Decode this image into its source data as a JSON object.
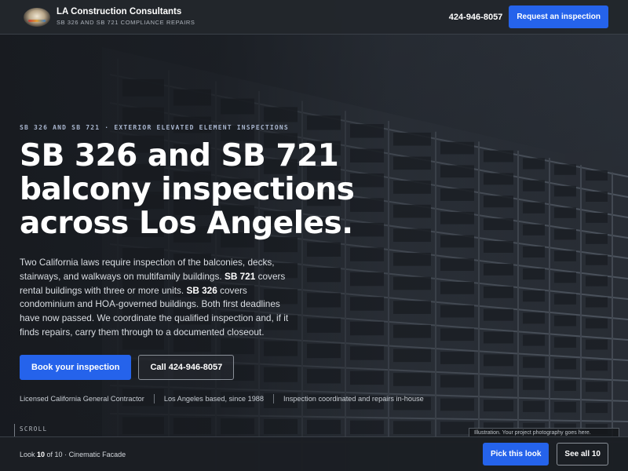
{
  "header": {
    "brand_name": "LA Construction Consultants",
    "brand_sub": "SB 326 AND SB 721 COMPLIANCE REPAIRS",
    "phone": "424-946-8057",
    "cta_label": "Request an inspection"
  },
  "hero": {
    "eyebrow": "SB 326 AND SB 721 · EXTERIOR ELEVATED ELEMENT INSPECTIONS",
    "headline": "SB 326 and SB 721 balcony inspections across Los Angeles.",
    "lede": {
      "part1": "Two California laws require inspection of the balconies, decks, stairways, and walkways on multifamily buildings. ",
      "sb721": "SB 721",
      "part2": " covers rental buildings with three or more units. ",
      "sb326": "SB 326",
      "part3": " covers condominium and HOA-governed buildings. Both first deadlines have now passed. We coordinate the qualified inspection and, if it finds repairs, carry them through to a documented closeout."
    },
    "primary_cta": "Book your inspection",
    "secondary_cta": "Call 424-946-8057",
    "trust": [
      "Licensed California General Contractor",
      "Los Angeles based, since 1988",
      "Inspection coordinated and repairs in-house"
    ]
  },
  "scroll_label": "SCROLL",
  "caption": "Illustration. Your project photography goes here.",
  "bottom_bar": {
    "look_prefix": "Look ",
    "look_current": "10",
    "look_suffix": " of 10 · Cinematic Facade",
    "pick_label": "Pick this look",
    "see_all_label": "See all 10"
  },
  "colors": {
    "accent": "#2563eb",
    "background": "#1b1f24",
    "header_bg": "#22262c",
    "eyebrow": "#a9b6cf"
  },
  "icons": {
    "logo": "company-logo-icon"
  }
}
